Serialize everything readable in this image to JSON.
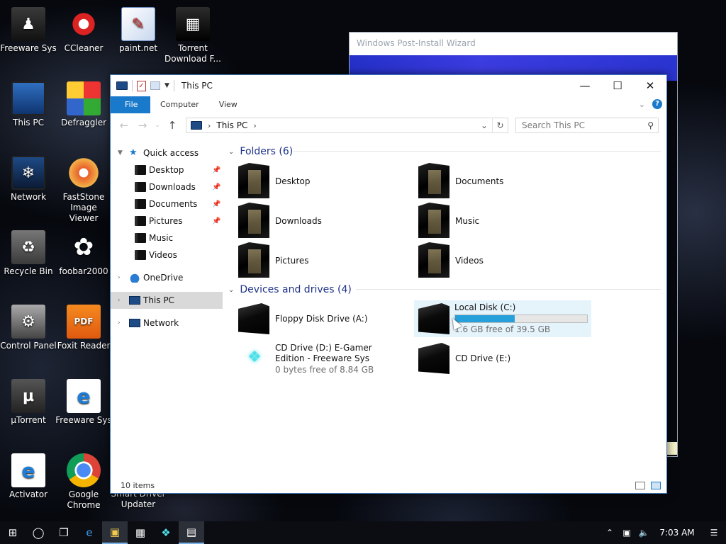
{
  "desktop": {
    "icons": [
      {
        "label": "Freeware Sys",
        "icon": "user-icon"
      },
      {
        "label": "CCleaner",
        "icon": "ccleaner-icon"
      },
      {
        "label": "paint.net",
        "icon": "paintnet-icon"
      },
      {
        "label": "Torrent Download F...",
        "icon": "torrent-download-icon"
      },
      {
        "label": "This PC",
        "icon": "monitor-icon"
      },
      {
        "label": "Defraggler",
        "icon": "defraggler-icon"
      },
      {
        "label": "Network",
        "icon": "network-icon"
      },
      {
        "label": "FastStone Image Viewer",
        "icon": "faststone-icon"
      },
      {
        "label": "Recycle Bin",
        "icon": "recycle-bin-icon"
      },
      {
        "label": "foobar2000",
        "icon": "foobar-icon"
      },
      {
        "label": "Control Panel",
        "icon": "control-panel-icon"
      },
      {
        "label": "Foxit Reader",
        "icon": "foxit-icon"
      },
      {
        "label": "µTorrent",
        "icon": "utorrent-icon"
      },
      {
        "label": "Freeware Sys",
        "icon": "edge-icon"
      },
      {
        "label": "Activator",
        "icon": "activator-icon"
      },
      {
        "label": "Google Chrome",
        "icon": "chrome-icon"
      },
      {
        "label": "Smart Driver Updater",
        "icon": "smart-driver-icon"
      }
    ]
  },
  "wizard": {
    "title": "Windows Post-Install Wizard"
  },
  "explorer": {
    "title": "This PC",
    "ribbon": {
      "file": "File",
      "computer": "Computer",
      "view": "View"
    },
    "address": {
      "location": "This PC"
    },
    "search": {
      "placeholder": "Search This PC"
    },
    "nav": {
      "quick_access": "Quick access",
      "quick_items": [
        "Desktop",
        "Downloads",
        "Documents",
        "Pictures",
        "Music",
        "Videos"
      ],
      "onedrive": "OneDrive",
      "this_pc": "This PC",
      "network": "Network"
    },
    "folders": {
      "heading": "Folders (6)",
      "items": [
        "Desktop",
        "Documents",
        "Downloads",
        "Music",
        "Pictures",
        "Videos"
      ]
    },
    "devices": {
      "heading": "Devices and drives (4)",
      "floppy": "Floppy Disk Drive (A:)",
      "local_disk": {
        "name": "Local Disk (C:)",
        "free": "1.6 GB free of 39.5 GB",
        "used_fraction": 0.45
      },
      "cd_d": {
        "name": "CD Drive (D:) E-Gamer Edition - Freeware Sys",
        "free": "0 bytes free of 8.84 GB"
      },
      "cd_e": "CD Drive (E:)"
    },
    "status": "10 items"
  },
  "taskbar": {
    "clock": "7:03 AM"
  }
}
